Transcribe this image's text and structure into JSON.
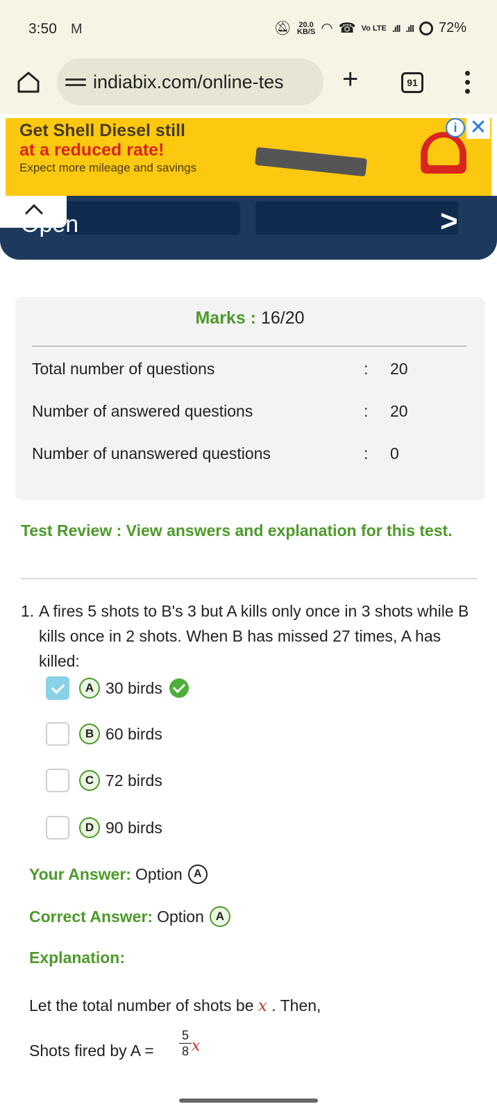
{
  "status_bar": {
    "time": "3:50",
    "speed_value": "20.0",
    "speed_unit": "KB/S",
    "volte": "Vo LTE",
    "battery": "72%"
  },
  "browser": {
    "url": "indiabix.com/online-tes",
    "tab_count": "91"
  },
  "ad": {
    "headline": "Get Shell Diesel still",
    "highlight": "at a reduced rate!",
    "subline": "Expect more mileage and savings",
    "brand_color": "#fcc910",
    "accent_color": "#d9251d"
  },
  "nav": {
    "open_label": "Open"
  },
  "summary": {
    "marks_label": "Marks :",
    "marks_value": "16/20",
    "rows": [
      {
        "label": "Total number of questions",
        "colon": ":",
        "value": "20"
      },
      {
        "label": "Number of answered questions",
        "colon": ":",
        "value": "20"
      },
      {
        "label": "Number of unanswered questions",
        "colon": ":",
        "value": "0"
      }
    ]
  },
  "review_heading": "Test Review : View answers and explanation for this test.",
  "question": {
    "number": "1.",
    "text": "A fires 5 shots to B's 3 but A kills only once in 3 shots while B kills once in 2 shots. When B has missed 27 times, A has killed:",
    "options": [
      {
        "letter": "A",
        "text": "30 birds",
        "checked": true,
        "correct": true
      },
      {
        "letter": "B",
        "text": "60 birds",
        "checked": false
      },
      {
        "letter": "C",
        "text": "72 birds",
        "checked": false
      },
      {
        "letter": "D",
        "text": "90 birds",
        "checked": false
      }
    ],
    "your_answer_label": "Your Answer:",
    "your_answer_text": "Option",
    "your_answer_letter": "A",
    "correct_answer_label": "Correct Answer:",
    "correct_answer_text": "Option",
    "correct_answer_letter": "A",
    "explanation_label": "Explanation:",
    "explanation_line1_prefix": "Let the total number of shots be",
    "explanation_var": "x",
    "explanation_line1_suffix": ". Then,",
    "explanation_line2_prefix": "Shots fired by A =",
    "frac_num": "5",
    "frac_den": "8",
    "frac_var": "x"
  },
  "colors": {
    "green": "#4c9a2a",
    "navy": "#1d3a5c",
    "checkbox": "#8bd1e6"
  }
}
